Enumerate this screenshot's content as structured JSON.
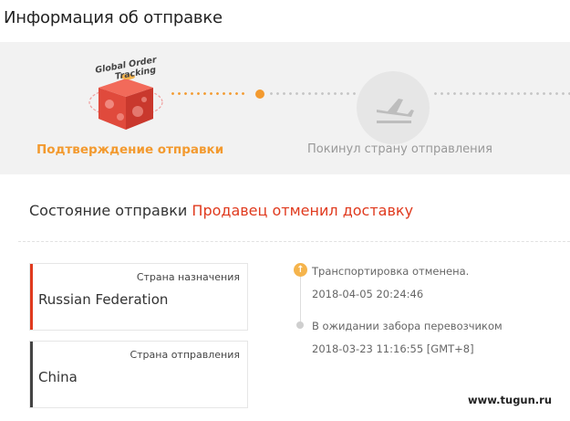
{
  "header": {
    "title": "Информация об отправке"
  },
  "progress": {
    "badge_line1": "Global Order",
    "badge_line2": "Tracking",
    "step1_label": "Подтверждение отправки",
    "step2_label": "Покинул страну отправления",
    "active_color": "#f39a2f",
    "inactive_color": "#c4c4c4"
  },
  "status": {
    "label": "Состояние отправки",
    "value": "Продавец отменил доставку",
    "value_color": "#e03a1e"
  },
  "destination": {
    "label": "Страна назначения",
    "value": "Russian Federation"
  },
  "origin": {
    "label": "Страна отправления",
    "value": "China"
  },
  "events": [
    {
      "text": "Транспортировка отменена.",
      "time": "2018-04-05 20:24:46"
    },
    {
      "text": "В ожидании забора перевозчиком",
      "time": "2018-03-23 11:16:55 [GMT+8]"
    }
  ],
  "watermark": "www.tugun.ru"
}
